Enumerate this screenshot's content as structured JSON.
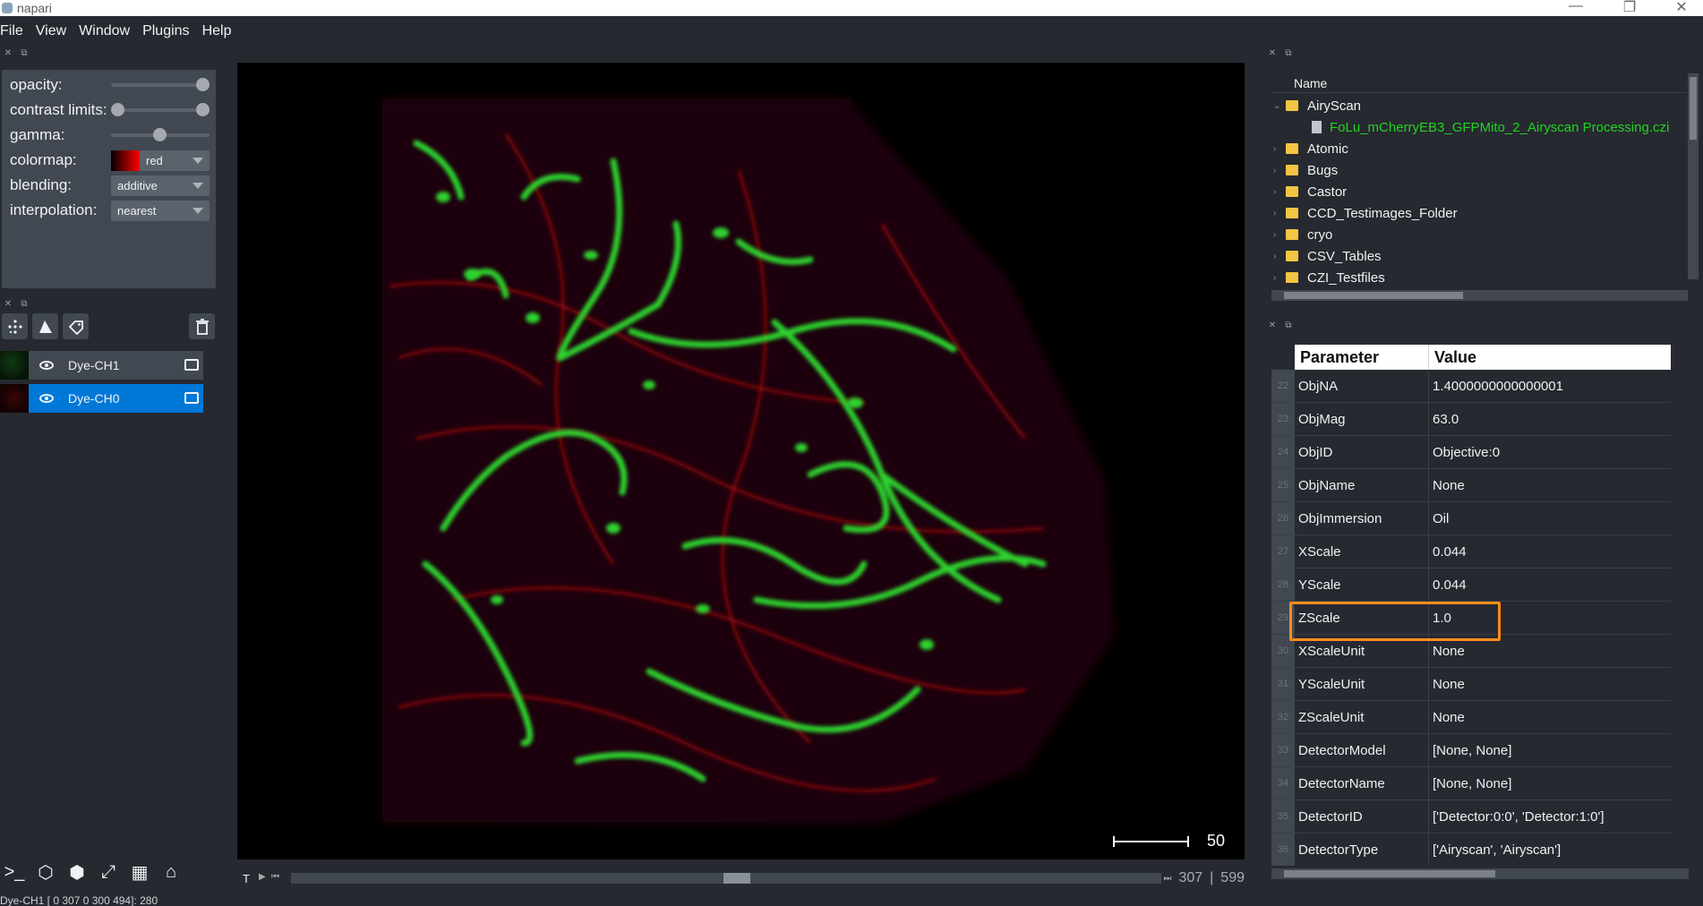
{
  "window": {
    "title": "napari"
  },
  "menu": [
    "File",
    "View",
    "Window",
    "Plugins",
    "Help"
  ],
  "layer_controls": {
    "opacity_label": "opacity:",
    "contrast_label": "contrast limits:",
    "gamma_label": "gamma:",
    "colormap_label": "colormap:",
    "colormap_value": "red",
    "blending_label": "blending:",
    "blending_value": "additive",
    "interpolation_label": "interpolation:",
    "interpolation_value": "nearest",
    "opacity_level": 1.0,
    "contrast_low": 0.0,
    "contrast_high": 1.0,
    "gamma_level": 0.5
  },
  "layers": [
    {
      "name": "Dye-CH1",
      "selected": false
    },
    {
      "name": "Dye-CH0",
      "selected": true
    }
  ],
  "canvas": {
    "scalebar_label": "50"
  },
  "dims": {
    "axis_label": "T",
    "current": "307",
    "total": "599"
  },
  "status": {
    "text": "Dye-CH1 [  0 307   0 300 494]: 280"
  },
  "file_browser": {
    "header": "Name",
    "items": [
      {
        "label": "AiryScan",
        "type": "folder",
        "expanded": true
      },
      {
        "label": "FoLu_mCherryEB3_GFPMito_2_Airyscan Processing.czi",
        "type": "file",
        "highlight": true
      },
      {
        "label": "Atomic",
        "type": "folder"
      },
      {
        "label": "Bugs",
        "type": "folder"
      },
      {
        "label": "Castor",
        "type": "folder"
      },
      {
        "label": "CCD_Testimages_Folder",
        "type": "folder"
      },
      {
        "label": "cryo",
        "type": "folder"
      },
      {
        "label": "CSV_Tables",
        "type": "folder"
      },
      {
        "label": "CZI_Testfiles",
        "type": "folder"
      }
    ]
  },
  "metadata_table": {
    "header_param": "Parameter",
    "header_value": "Value",
    "rows": [
      {
        "n": "22",
        "param": "ObjNA",
        "value": "1.4000000000000001"
      },
      {
        "n": "23",
        "param": "ObjMag",
        "value": "63.0"
      },
      {
        "n": "24",
        "param": "ObjID",
        "value": "Objective:0"
      },
      {
        "n": "25",
        "param": "ObjName",
        "value": "None"
      },
      {
        "n": "26",
        "param": "ObjImmersion",
        "value": "Oil"
      },
      {
        "n": "27",
        "param": "XScale",
        "value": "0.044"
      },
      {
        "n": "28",
        "param": "YScale",
        "value": "0.044"
      },
      {
        "n": "29",
        "param": "ZScale",
        "value": "1.0"
      },
      {
        "n": "30",
        "param": "XScaleUnit",
        "value": "None"
      },
      {
        "n": "31",
        "param": "YScaleUnit",
        "value": "None"
      },
      {
        "n": "32",
        "param": "ZScaleUnit",
        "value": "None"
      },
      {
        "n": "33",
        "param": "DetectorModel",
        "value": "[None, None]"
      },
      {
        "n": "34",
        "param": "DetectorName",
        "value": "[None, None]"
      },
      {
        "n": "35",
        "param": "DetectorID",
        "value": "['Detector:0:0', 'Detector:1:0']"
      },
      {
        "n": "36",
        "param": "DetectorType",
        "value": "['Airyscan', 'Airyscan']"
      }
    ]
  },
  "colors": {
    "bg": "#262930",
    "panel": "#414851",
    "selected": "#0078d7",
    "highlight_box": "#ff8c1a",
    "file_highlight": "#22d322"
  }
}
